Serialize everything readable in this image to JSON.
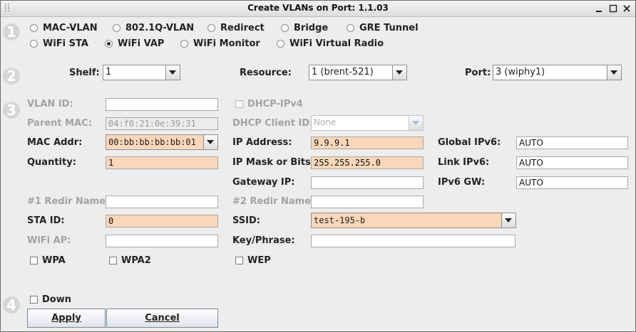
{
  "window": {
    "title": "Create VLANs on Port: 1.1.03"
  },
  "steps": [
    "1",
    "2",
    "3",
    "4"
  ],
  "types": [
    {
      "label": "MAC-VLAN",
      "selected": false
    },
    {
      "label": "802.1Q-VLAN",
      "selected": false
    },
    {
      "label": "Redirect",
      "selected": false
    },
    {
      "label": "Bridge",
      "selected": false
    },
    {
      "label": "GRE Tunnel",
      "selected": false
    },
    {
      "label": "WiFi STA",
      "selected": false
    },
    {
      "label": "WiFi VAP",
      "selected": true
    },
    {
      "label": "WiFi Monitor",
      "selected": false
    },
    {
      "label": "WiFi Virtual Radio",
      "selected": false
    }
  ],
  "location": {
    "shelf_label": "Shelf:",
    "shelf_value": "1",
    "resource_label": "Resource:",
    "resource_value": "1 (brent-521)",
    "port_label": "Port:",
    "port_value": "3 (wiphy1)"
  },
  "form": {
    "vlan_id_label": "VLAN ID:",
    "vlan_id_value": "",
    "parent_mac_label": "Parent MAC:",
    "parent_mac_value": "04:f0:21:0e:39:31",
    "mac_addr_label": "MAC Addr:",
    "mac_addr_value": "00:bb:bb:bb:bb:01",
    "quantity_label": "Quantity:",
    "quantity_value": "1",
    "redir1_label": "#1 Redir Name:",
    "redir1_value": "",
    "sta_id_label": "STA ID:",
    "sta_id_value": "0",
    "wifi_ap_label": "WiFi AP:",
    "wifi_ap_value": "",
    "dhcp_ipv4_label": "DHCP-IPv4",
    "dhcp_client_label": "DHCP Client ID:",
    "dhcp_client_value": "None",
    "ip_address_label": "IP Address:",
    "ip_address_value": "9.9.9.1",
    "ip_mask_label": "IP Mask or Bits:",
    "ip_mask_value": "255.255.255.0",
    "gateway_label": "Gateway IP:",
    "gateway_value": "",
    "redir2_label": "#2 Redir Name:",
    "redir2_value": "",
    "ssid_label": "SSID:",
    "ssid_value": "test-195-b",
    "key_label": "Key/Phrase:",
    "key_value": "",
    "global_ipv6_label": "Global IPv6:",
    "global_ipv6_value": "AUTO",
    "link_ipv6_label": "Link IPv6:",
    "link_ipv6_value": "AUTO",
    "ipv6_gw_label": "IPv6 GW:",
    "ipv6_gw_value": "AUTO",
    "wpa_label": "WPA",
    "wpa2_label": "WPA2",
    "wep_label": "WEP"
  },
  "footer": {
    "down_label": "Down",
    "apply_label": "Apply",
    "cancel_label": "Cancel"
  },
  "colors": {
    "required_field": "#fad7b8",
    "step_badge": "#d6d6d6"
  }
}
